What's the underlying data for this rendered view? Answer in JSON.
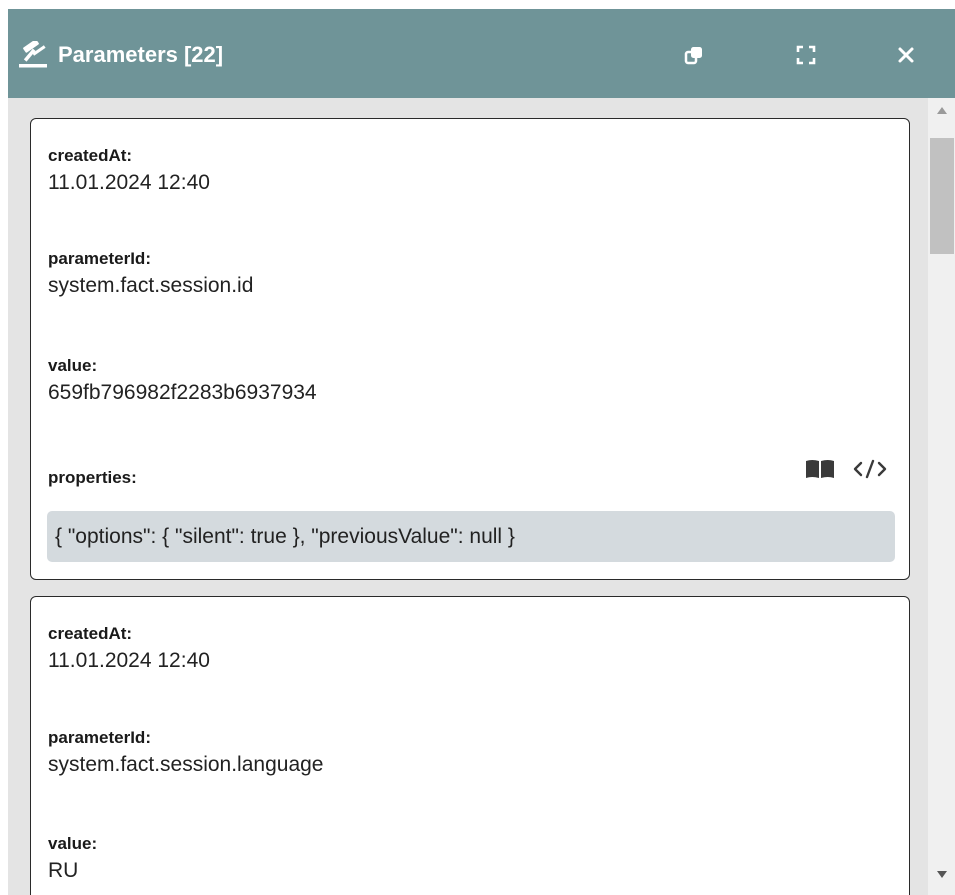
{
  "header": {
    "title": "Parameters [22]",
    "icons": [
      "gavel-icon",
      "copy-icon",
      "fullscreen-icon",
      "close-icon"
    ]
  },
  "records": [
    {
      "created_at_label": "createdAt:",
      "created_at": "11.01.2024 12:40",
      "parameter_id_label": "parameterId:",
      "parameter_id": "system.fact.session.id",
      "value_label": "value:",
      "value": "659fb796982f2283b6937934",
      "properties_label": "properties:",
      "properties": "{ \"options\": { \"silent\": true }, \"previousValue\": null }",
      "property_icons": [
        "book-icon",
        "code-icon"
      ]
    },
    {
      "created_at_label": "createdAt:",
      "created_at": "11.01.2024 12:40",
      "parameter_id_label": "parameterId:",
      "parameter_id": "system.fact.session.language",
      "value_label": "value:",
      "value": "RU"
    }
  ],
  "colors": {
    "header_bg": "#6f9498",
    "panel_bg": "#e4e4e4",
    "code_bg": "#d4dade"
  }
}
